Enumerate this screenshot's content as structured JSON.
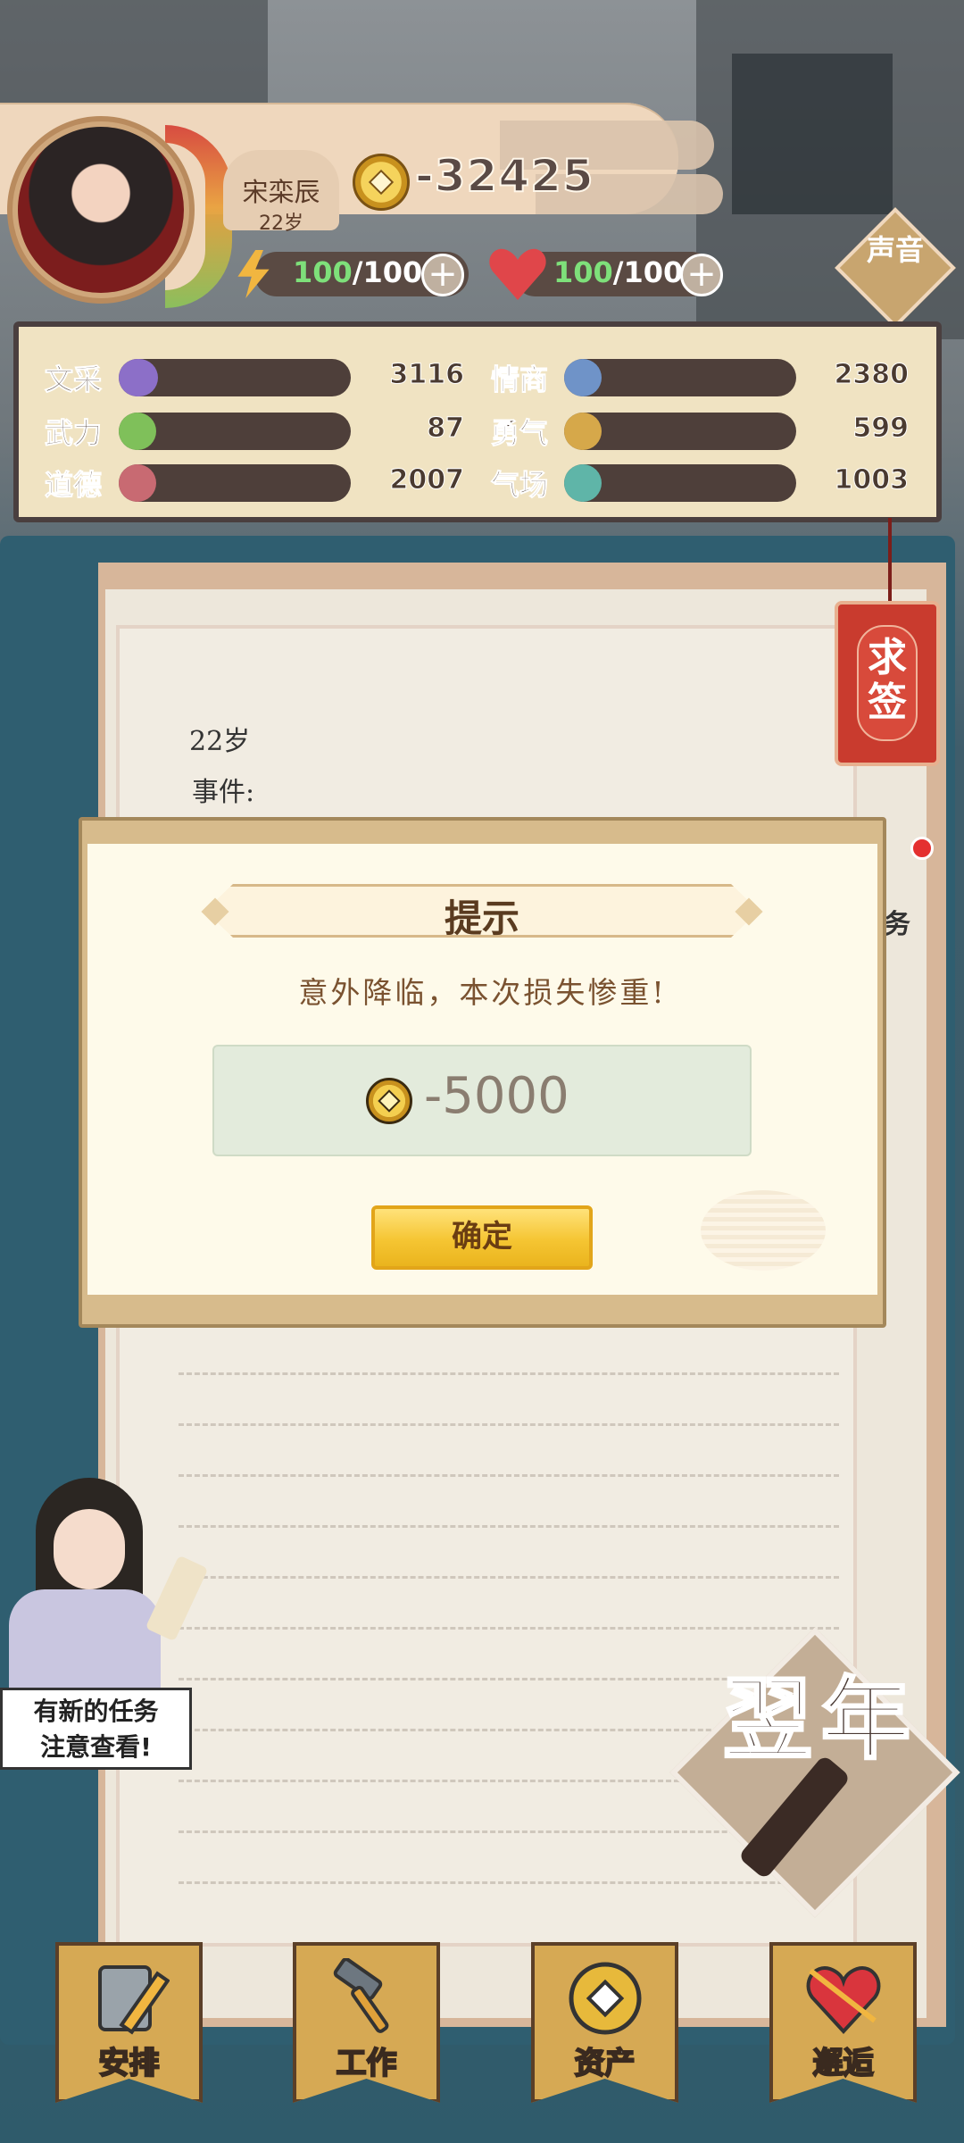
{
  "player": {
    "name": "宋栾辰",
    "age": "22岁",
    "coins": "-32425",
    "energy": {
      "current": "100",
      "max": "/100"
    },
    "health": {
      "current": "100",
      "max": "/100"
    }
  },
  "sound_label": "声音",
  "stats": [
    {
      "label": "文采",
      "value": "3116",
      "color": "#8c6fc8",
      "fill": 0.17
    },
    {
      "label": "情商",
      "value": "2380",
      "color": "#6f93c8",
      "fill": 0.15
    },
    {
      "label": "武力",
      "value": "87",
      "color": "#7fc05a",
      "fill": 0.06
    },
    {
      "label": "勇气",
      "value": "599",
      "color": "#d6a84a",
      "fill": 0.08
    },
    {
      "label": "道德",
      "value": "2007",
      "color": "#c86a72",
      "fill": 0.13
    },
    {
      "label": "气场",
      "value": "1003",
      "color": "#5fb5a8",
      "fill": 0.09
    }
  ],
  "notebook": {
    "age_line": "22岁",
    "event_line": "事件:"
  },
  "lot_label": "求签",
  "task_label": "务",
  "dialog": {
    "title": "提示",
    "message": "意外降临，本次损失惨重!",
    "amount": "-5000",
    "confirm_label": "确定"
  },
  "guide_text": "有新的任务\n注意查看!",
  "next_year_label": "翌年",
  "nav": [
    {
      "label": "安排",
      "icon": "notebook-pencil-icon"
    },
    {
      "label": "工作",
      "icon": "hammer-icon"
    },
    {
      "label": "资产",
      "icon": "coin-icon"
    },
    {
      "label": "邂逅",
      "icon": "heart-arrow-icon"
    }
  ]
}
